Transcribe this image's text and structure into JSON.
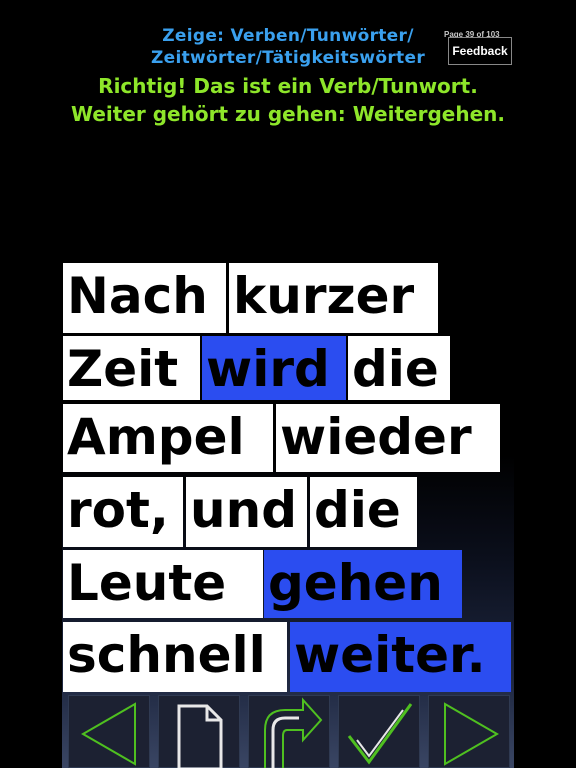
{
  "header": {
    "prompt_line1": "Zeige: Verben/Tunwörter/",
    "prompt_line2": "Zeitwörter/Tätigkeitswörter",
    "page_counter": "Page 39 of 103",
    "feedback_label": "Feedback"
  },
  "result": {
    "line1": "Richtig! Das ist ein Verb/Tunwort.",
    "line2": "Weiter gehört zu gehen: Weitergehen."
  },
  "sentence": {
    "words": [
      {
        "text": "Nach",
        "highlighted": false
      },
      {
        "text": "kurzer",
        "highlighted": false
      },
      {
        "text": "Zeit",
        "highlighted": false
      },
      {
        "text": "wird",
        "highlighted": true
      },
      {
        "text": "die",
        "highlighted": false
      },
      {
        "text": "Ampel",
        "highlighted": false
      },
      {
        "text": "wieder",
        "highlighted": false
      },
      {
        "text": "rot,",
        "highlighted": false
      },
      {
        "text": "und",
        "highlighted": false
      },
      {
        "text": "die",
        "highlighted": false
      },
      {
        "text": "Leute",
        "highlighted": false
      },
      {
        "text": "gehen",
        "highlighted": true
      },
      {
        "text": "schnell",
        "highlighted": false
      },
      {
        "text": "weiter.",
        "highlighted": true
      }
    ]
  },
  "colors": {
    "prompt": "#3aa0ee",
    "result": "#8ee62a",
    "highlight": "#2b4df0",
    "word_background": "#ffffff",
    "toolbar_outline": "#4fc020"
  },
  "toolbar": {
    "icons": [
      "previous-arrow-icon",
      "page-icon",
      "replay-arrow-icon",
      "checkmark-icon",
      "next-arrow-icon"
    ]
  }
}
